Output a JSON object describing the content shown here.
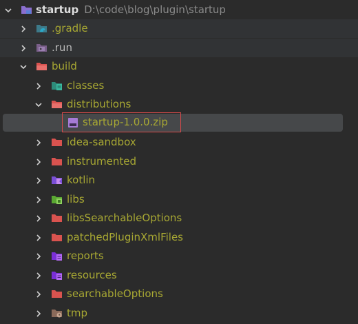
{
  "project": {
    "name": "startup",
    "path": "D:\\code\\blog\\plugin\\startup"
  },
  "items": [
    {
      "label": ".gradle",
      "icon": "gradle-folder-icon",
      "color": "#a8a833"
    },
    {
      "label": ".run",
      "icon": "run-folder-icon",
      "color": "#bbbbbb"
    },
    {
      "label": "build",
      "icon": "build-folder-icon",
      "color": "#a8a833"
    },
    {
      "label": "classes",
      "icon": "classes-folder-icon",
      "color": "#a8a833"
    },
    {
      "label": "distributions",
      "icon": "folder-icon",
      "color": "#a8a833"
    },
    {
      "label": "startup-1.0.0.zip",
      "icon": "zip-archive-icon",
      "color": "#a8a833"
    },
    {
      "label": "idea-sandbox",
      "icon": "folder-icon",
      "color": "#a8a833"
    },
    {
      "label": "instrumented",
      "icon": "folder-icon",
      "color": "#a8a833"
    },
    {
      "label": "kotlin",
      "icon": "kotlin-folder-icon",
      "color": "#a8a833"
    },
    {
      "label": "libs",
      "icon": "libs-folder-icon",
      "color": "#a8a833"
    },
    {
      "label": "libsSearchableOptions",
      "icon": "folder-icon",
      "color": "#a8a833"
    },
    {
      "label": "patchedPluginXmlFiles",
      "icon": "folder-icon",
      "color": "#a8a833"
    },
    {
      "label": "reports",
      "icon": "reports-folder-icon",
      "color": "#a8a833"
    },
    {
      "label": "resources",
      "icon": "resources-folder-icon",
      "color": "#a8a833"
    },
    {
      "label": "searchableOptions",
      "icon": "folder-icon",
      "color": "#a8a833"
    },
    {
      "label": "tmp",
      "icon": "tmp-folder-icon",
      "color": "#a8a833"
    }
  ],
  "colors": {
    "background": "#2b2b2b",
    "selection": "#46484a",
    "highlight_border": "#d94a4a",
    "excluded_text": "#a8a833",
    "normal_text": "#bbbbbb"
  }
}
